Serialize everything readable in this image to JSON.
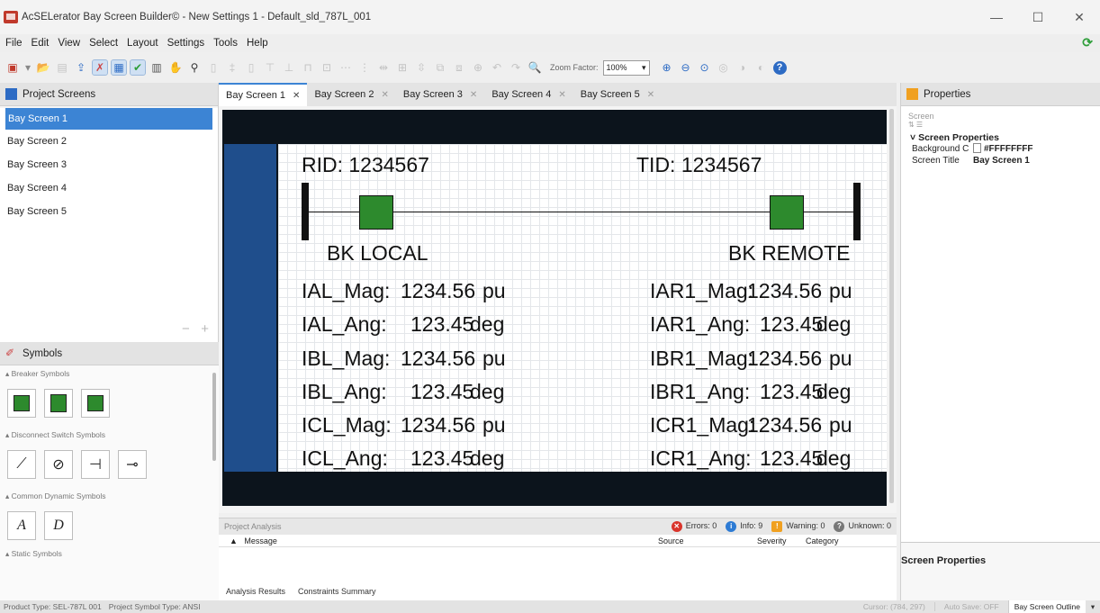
{
  "window": {
    "title": "AcSELerator Bay Screen Builder© - New Settings 1 - Default_sld_787L_001"
  },
  "menu": [
    "File",
    "Edit",
    "View",
    "Select",
    "Layout",
    "Settings",
    "Tools",
    "Help"
  ],
  "toolbar": {
    "zoom_label": "Zoom Factor:",
    "zoom_value": "100%"
  },
  "project_screens": {
    "header": "Project Screens",
    "items": [
      "Bay Screen 1",
      "Bay Screen 2",
      "Bay Screen 3",
      "Bay Screen 4",
      "Bay Screen 5"
    ],
    "selected_index": 0
  },
  "symbols": {
    "header": "Symbols",
    "groups": [
      "Breaker Symbols",
      "Disconnect Switch Symbols",
      "Common Dynamic Symbols",
      "Static Symbols"
    ],
    "dynamic_letters": [
      "A",
      "D"
    ]
  },
  "tabs": [
    "Bay Screen 1",
    "Bay Screen 2",
    "Bay Screen 3",
    "Bay Screen 4",
    "Bay Screen 5"
  ],
  "canvas": {
    "rid": "RID:  1234567",
    "tid": "TID:  1234567",
    "left_label": "BK LOCAL",
    "right_label": "BK REMOTE",
    "left_rows": [
      {
        "name": "IAL_Mag:",
        "value": "1234.56",
        "unit": "pu"
      },
      {
        "name": "IAL_Ang:",
        "value": "123.45",
        "unit": "deg"
      },
      {
        "name": "IBL_Mag:",
        "value": "1234.56",
        "unit": "pu"
      },
      {
        "name": "IBL_Ang:",
        "value": "123.45",
        "unit": "deg"
      },
      {
        "name": "ICL_Mag:",
        "value": "1234.56",
        "unit": "pu"
      },
      {
        "name": "ICL_Ang:",
        "value": "123.45",
        "unit": "deg"
      }
    ],
    "right_rows": [
      {
        "name": "IAR1_Mag:",
        "value": "1234.56",
        "unit": "pu"
      },
      {
        "name": "IAR1_Ang:",
        "value": "123.45",
        "unit": "deg"
      },
      {
        "name": "IBR1_Mag:",
        "value": "1234.56",
        "unit": "pu"
      },
      {
        "name": "IBR1_Ang:",
        "value": "123.45",
        "unit": "deg"
      },
      {
        "name": "ICR1_Mag:",
        "value": "1234.56",
        "unit": "pu"
      },
      {
        "name": "ICR1_Ang:",
        "value": "123.45",
        "unit": "deg"
      }
    ]
  },
  "analysis": {
    "title": "Project Analysis",
    "errors": "Errors: 0",
    "info": "Info: 9",
    "warning": "Warning: 0",
    "unknown": "Unknown: 0",
    "columns": [
      "Message",
      "Source",
      "Severity",
      "Category"
    ],
    "tabs": [
      "Analysis Results",
      "Constraints Summary"
    ]
  },
  "properties": {
    "header": "Properties",
    "object": "Screen",
    "category": "Screen Properties",
    "rows": [
      {
        "key": "Background C",
        "value": "#FFFFFFFF"
      },
      {
        "key": "Screen Title",
        "value": "Bay Screen 1"
      }
    ],
    "description_title": "Screen Properties"
  },
  "status": {
    "product": "Product Type: SEL-787L 001",
    "symbol_type": "Project Symbol Type: ANSI",
    "cursor": "Cursor:  (784, 297)",
    "autosave": "Auto Save: OFF",
    "outline": "Bay Screen Outline"
  },
  "colors": {
    "accent": "#3c84d4",
    "breaker": "#2d8a2d",
    "canvas_bg": "#0c141c",
    "strip": "#1f4e8c"
  }
}
